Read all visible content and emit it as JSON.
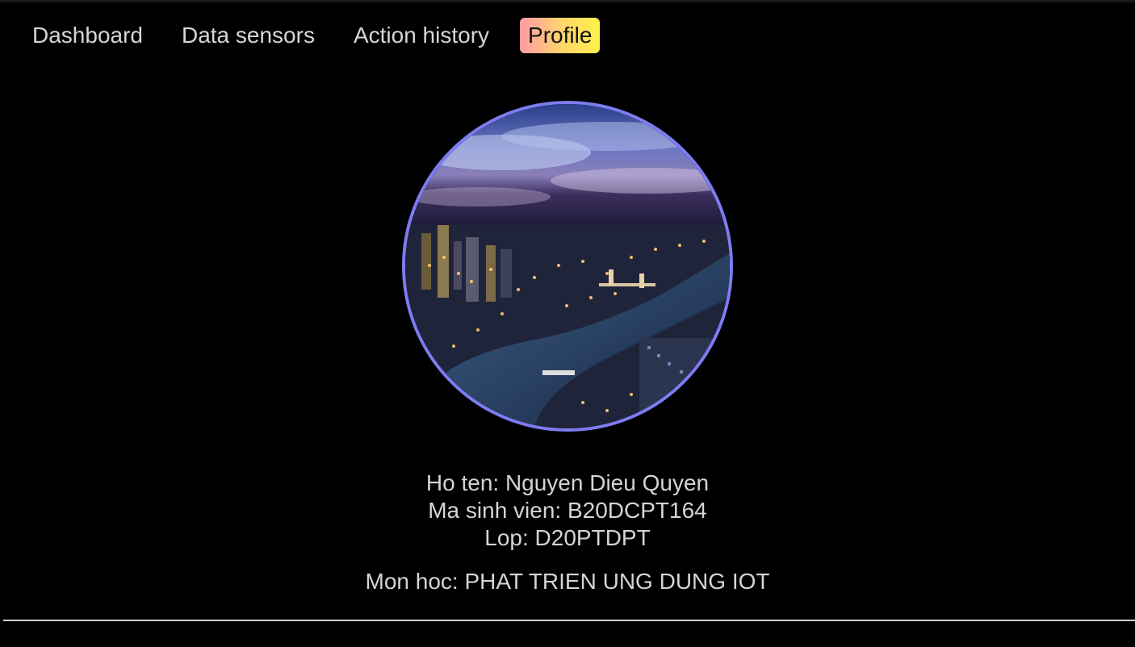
{
  "nav": {
    "items": [
      {
        "label": "Dashboard"
      },
      {
        "label": "Data sensors"
      },
      {
        "label": "Action history"
      },
      {
        "label": "Profile",
        "active": true
      }
    ]
  },
  "profile": {
    "avatar_icon": "city-night-photo",
    "name_line": "Ho ten: Nguyen Dieu Quyen",
    "student_id_line": "Ma sinh vien: B20DCPT164",
    "class_line": "Lop: D20PTDPT",
    "subject_line": "Mon hoc: PHAT TRIEN UNG DUNG IOT"
  },
  "colors": {
    "background": "#000000",
    "avatar_border": "#7d7cf2",
    "active_tab_gradient_start": "#ff9aa6",
    "active_tab_gradient_end": "#fff04d"
  }
}
